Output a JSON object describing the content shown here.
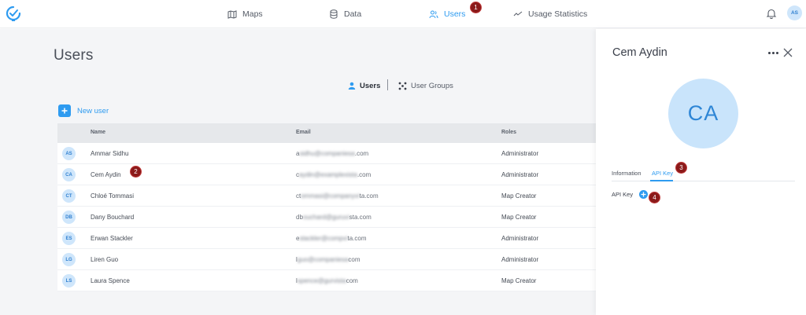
{
  "nav": {
    "maps": "Maps",
    "data": "Data",
    "users": "Users",
    "usage": "Usage Statistics"
  },
  "user_avatar": "AS",
  "markers": {
    "m1": "1",
    "m2": "2",
    "m3": "3",
    "m4": "4"
  },
  "page": {
    "title": "Users",
    "seg_users": "Users",
    "seg_groups": "User Groups",
    "new_user": "New user"
  },
  "table": {
    "headers": {
      "name": "Name",
      "email": "Email",
      "roles": "Roles"
    },
    "rows": [
      {
        "initials": "AS",
        "name": "Ammar Sidhu",
        "email_start": "a",
        "email_hidden": "sidhu@companiesa",
        "email_end": ".com",
        "role": "Administrator"
      },
      {
        "initials": "CA",
        "name": "Cem Aydin",
        "email_start": "c",
        "email_hidden": "aydin@examplexista",
        "email_end": ".com",
        "role": "Administrator"
      },
      {
        "initials": "CT",
        "name": "Chloé Tommasi",
        "email_start": "ct",
        "email_hidden": "ommasi@companyvi",
        "email_end": "ta.com",
        "role": "Map Creator"
      },
      {
        "initials": "DB",
        "name": "Dany Bouchard",
        "email_start": "db",
        "email_hidden": "ouchard@guruvi",
        "email_end": "sta.com",
        "role": "Map Creator"
      },
      {
        "initials": "ES",
        "name": "Erwan Stackler",
        "email_start": "e",
        "email_hidden": "stackler@compvi",
        "email_end": "ta.com",
        "role": "Administrator"
      },
      {
        "initials": "LG",
        "name": "Liren Guo",
        "email_start": "l",
        "email_hidden": "guo@companiesa",
        "email_end": "com",
        "role": "Administrator"
      },
      {
        "initials": "LS",
        "name": "Laura Spence",
        "email_start": "l",
        "email_hidden": "spence@gurvista",
        "email_end": "com",
        "role": "Map Creator"
      }
    ]
  },
  "panel": {
    "name": "Cem Aydin",
    "initials": "CA",
    "tab_info": "Information",
    "tab_api": "API Key",
    "api_key_label": "API Key"
  },
  "colors": {
    "accent": "#2e9bf0",
    "marker": "#8b1a1a",
    "avatar_bg": "#cfe6fb"
  }
}
